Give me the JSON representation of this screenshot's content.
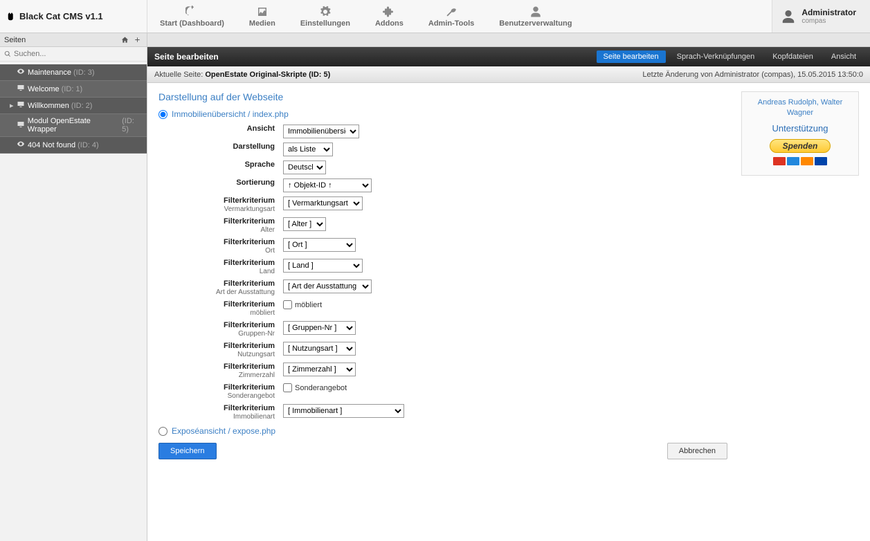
{
  "brand": "Black Cat CMS v1.1",
  "nav": [
    {
      "label": "Start (Dashboard)",
      "icon": "dashboard"
    },
    {
      "label": "Medien",
      "icon": "image"
    },
    {
      "label": "Einstellungen",
      "icon": "gears"
    },
    {
      "label": "Addons",
      "icon": "puzzle"
    },
    {
      "label": "Admin-Tools",
      "icon": "wrench"
    },
    {
      "label": "Benutzerverwaltung",
      "icon": "user"
    }
  ],
  "user": {
    "name": "Administrator",
    "company": "compas"
  },
  "sidebar_header": "Seiten",
  "search_placeholder": "Suchen...",
  "tree": [
    {
      "label": "Maintenance",
      "id": "(ID: 3)",
      "icon": "eye"
    },
    {
      "label": "Welcome",
      "id": "(ID: 1)",
      "icon": "screen"
    },
    {
      "label": "Willkommen",
      "id": "(ID: 2)",
      "icon": "screen",
      "expandable": true
    },
    {
      "label": "Modul OpenEstate Wrapper",
      "id": "(ID: 5)",
      "icon": "screen"
    },
    {
      "label": "404 Not found",
      "id": "(ID: 4)",
      "icon": "eye"
    }
  ],
  "black_bar_title": "Seite bearbeiten",
  "tabs": [
    {
      "label": "Seite bearbeiten",
      "active": true
    },
    {
      "label": "Sprach-Verknüpfungen"
    },
    {
      "label": "Kopfdateien"
    },
    {
      "label": "Ansicht"
    }
  ],
  "gray_bar": {
    "prefix": "Aktuelle Seite: ",
    "page": "OpenEstate Original-Skripte (ID: 5)",
    "right": "Letzte Änderung von Administrator (compas), 15.05.2015 13:50:0"
  },
  "section_title": "Darstellung auf der Webseite",
  "r1_title": "Immobilienübersicht / index.php",
  "r2_title": "Exposéansicht / expose.php",
  "rows": {
    "ansicht": {
      "label": "Ansicht",
      "value": "Immobilienübersicht"
    },
    "darstellung": {
      "label": "Darstellung",
      "value": "als Liste"
    },
    "sprache": {
      "label": "Sprache",
      "value": "Deutsch"
    },
    "sort": {
      "label": "Sortierung",
      "value": "↑ Objekt-ID ↑"
    },
    "f_verm": {
      "label": "Filterkriterium",
      "sub": "Vermarktungsart",
      "value": "[ Vermarktungsart ]"
    },
    "f_alter": {
      "label": "Filterkriterium",
      "sub": "Alter",
      "value": "[ Alter ]"
    },
    "f_ort": {
      "label": "Filterkriterium",
      "sub": "Ort",
      "value": "[ Ort ]"
    },
    "f_land": {
      "label": "Filterkriterium",
      "sub": "Land",
      "value": "[ Land ]"
    },
    "f_ausst": {
      "label": "Filterkriterium",
      "sub": "Art der Ausstattung",
      "value": "[ Art der Ausstattung ]"
    },
    "f_moeb": {
      "label": "Filterkriterium",
      "sub": "möbliert",
      "chk": "möbliert"
    },
    "f_grp": {
      "label": "Filterkriterium",
      "sub": "Gruppen-Nr",
      "value": "[ Gruppen-Nr ]"
    },
    "f_nutz": {
      "label": "Filterkriterium",
      "sub": "Nutzungsart",
      "value": "[ Nutzungsart ]"
    },
    "f_zimm": {
      "label": "Filterkriterium",
      "sub": "Zimmerzahl",
      "value": "[ Zimmerzahl ]"
    },
    "f_sonder": {
      "label": "Filterkriterium",
      "sub": "Sonderangebot",
      "chk": "Sonderangebot"
    },
    "f_immo": {
      "label": "Filterkriterium",
      "sub": "Immobilienart",
      "value": "[ Immobilienart ]"
    }
  },
  "btn_save": "Speichern",
  "btn_cancel": "Abbrechen",
  "rsb": {
    "authors": "Andreas Rudolph, Walter Wagner",
    "support": "Unterstützung",
    "donate": "Spenden"
  }
}
